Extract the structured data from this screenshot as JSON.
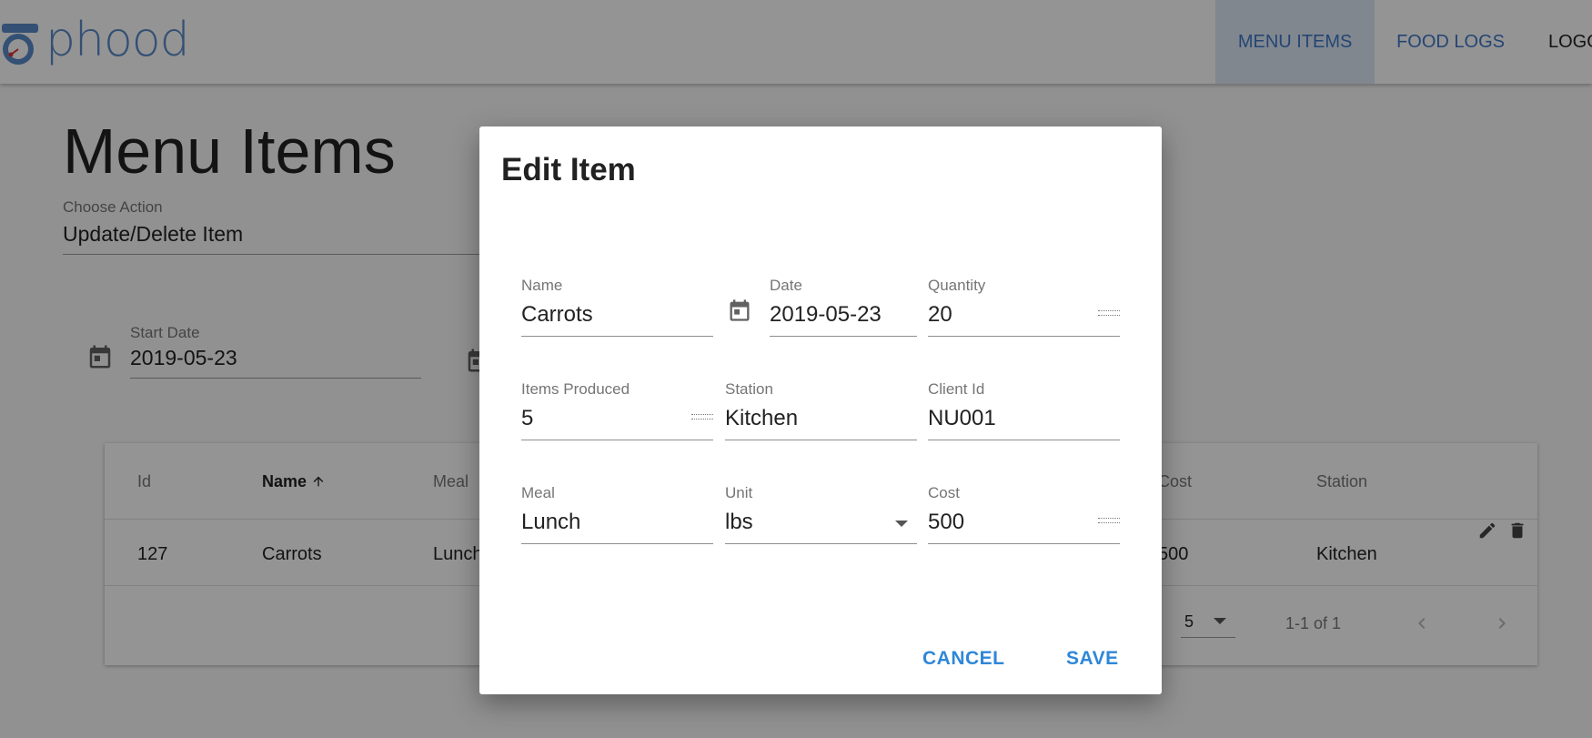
{
  "app": {
    "logo_text": "phood",
    "nav": [
      "MENU ITEMS",
      "FOOD LOGS",
      "LOGO"
    ],
    "accent": "#3f78c8"
  },
  "page": {
    "title": "Menu Items",
    "choose_action": {
      "label": "Choose Action",
      "value": "Update/Delete Item"
    },
    "start_date": {
      "label": "Start Date",
      "value": "2019-05-23"
    }
  },
  "table": {
    "headers": [
      "Id",
      "Name",
      "Meal",
      "Cost",
      "Station"
    ],
    "sort_icon": "arrow-up-icon",
    "row": {
      "id": "127",
      "name": "Carrots",
      "meal": "Lunch",
      "cost": "500",
      "station": "Kitchen"
    },
    "rows_per_page": "5",
    "range": "1-1 of 1"
  },
  "dialog": {
    "title": "Edit Item",
    "fields": {
      "name": {
        "label": "Name",
        "value": "Carrots"
      },
      "date": {
        "label": "Date",
        "value": "2019-05-23"
      },
      "quantity": {
        "label": "Quantity",
        "value": "20"
      },
      "items_produced": {
        "label": "Items Produced",
        "value": "5"
      },
      "station": {
        "label": "Station",
        "value": "Kitchen"
      },
      "client_id": {
        "label": "Client Id",
        "value": "NU001"
      },
      "meal": {
        "label": "Meal",
        "value": "Lunch"
      },
      "unit": {
        "label": "Unit",
        "value": "lbs"
      },
      "cost": {
        "label": "Cost",
        "value": "500"
      }
    },
    "cancel": "CANCEL",
    "save": "SAVE",
    "button_color": "#2f87d8"
  }
}
